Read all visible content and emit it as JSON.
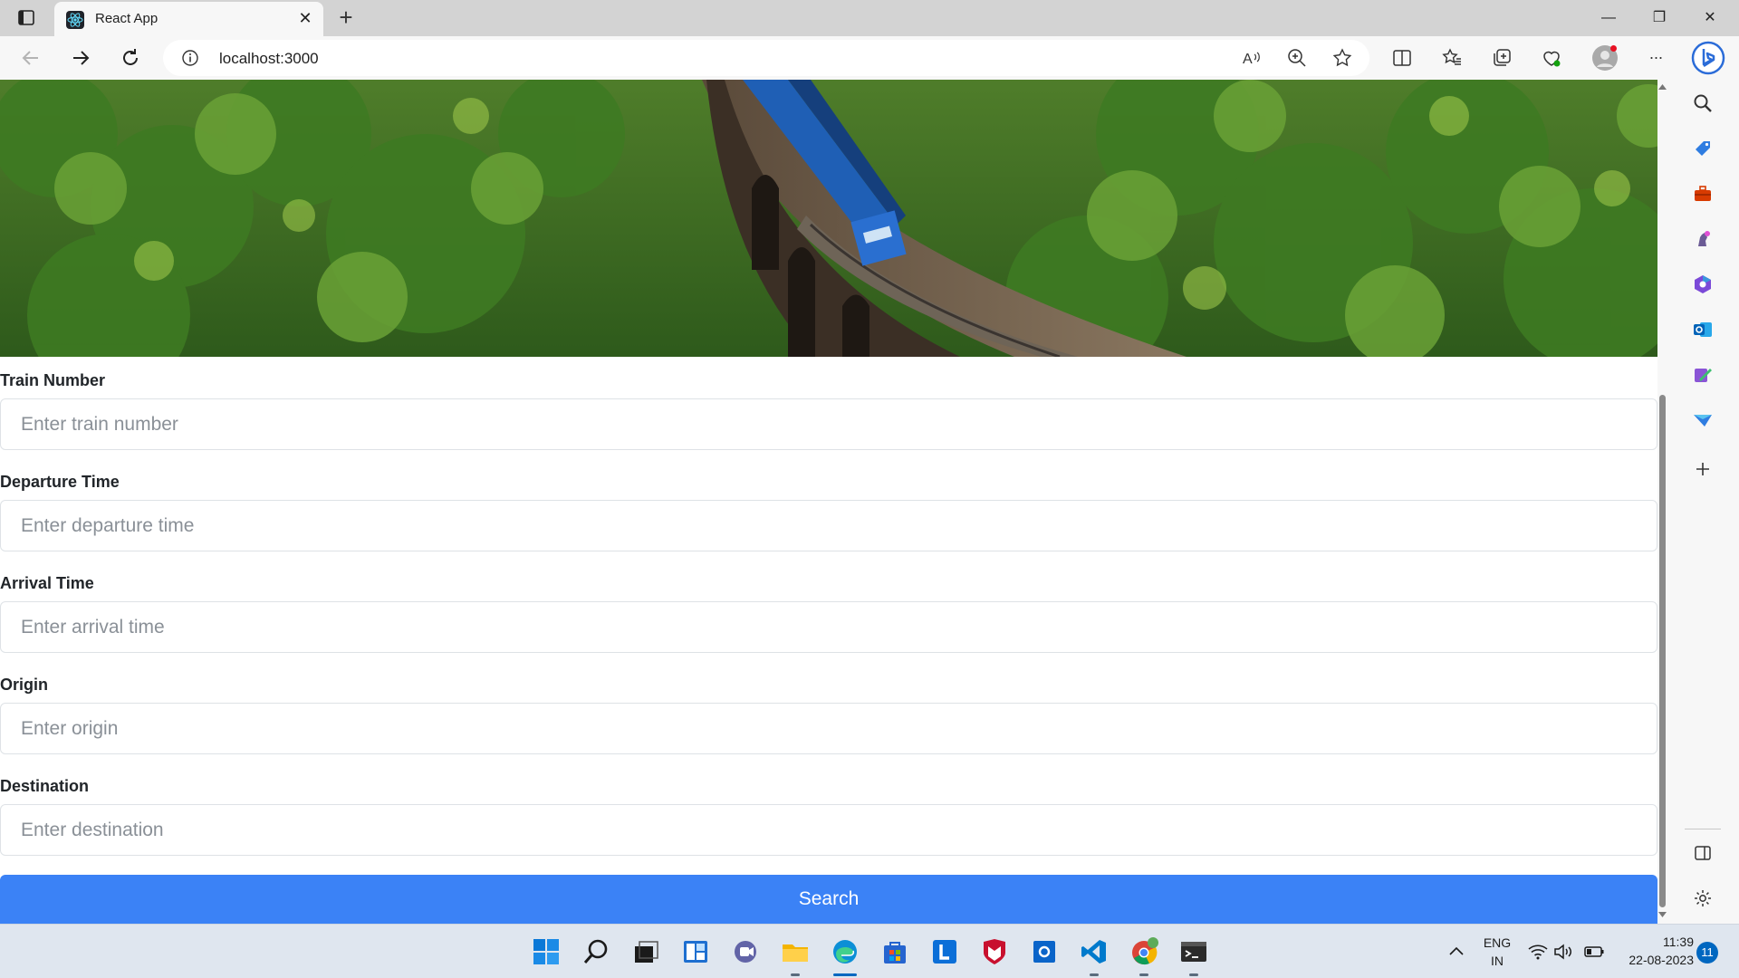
{
  "browser": {
    "tab_title": "React App",
    "close_tab_glyph": "✕",
    "new_tab_glyph": "+",
    "url": "localhost:3000",
    "window_controls": {
      "minimize": "—",
      "maximize": "❐",
      "close": "✕"
    },
    "more_glyph": "···"
  },
  "hero": {
    "image_subject": "blue train crossing a stone arch bridge through jungle"
  },
  "form": {
    "fields": [
      {
        "label": "Train Number",
        "placeholder": "Enter train number"
      },
      {
        "label": "Departure Time",
        "placeholder": "Enter departure time"
      },
      {
        "label": "Arrival Time",
        "placeholder": "Enter arrival time"
      },
      {
        "label": "Origin",
        "placeholder": "Enter origin"
      },
      {
        "label": "Destination",
        "placeholder": "Enter destination"
      }
    ],
    "submit_label": "Search"
  },
  "taskbar": {
    "language": "ENG",
    "region": "IN",
    "time": "11:39",
    "date": "22-08-2023",
    "notifications": "11"
  },
  "colors": {
    "accent": "#3b82f6",
    "taskbar": "#dfe6ef",
    "chrome": "#f7f7f7"
  }
}
